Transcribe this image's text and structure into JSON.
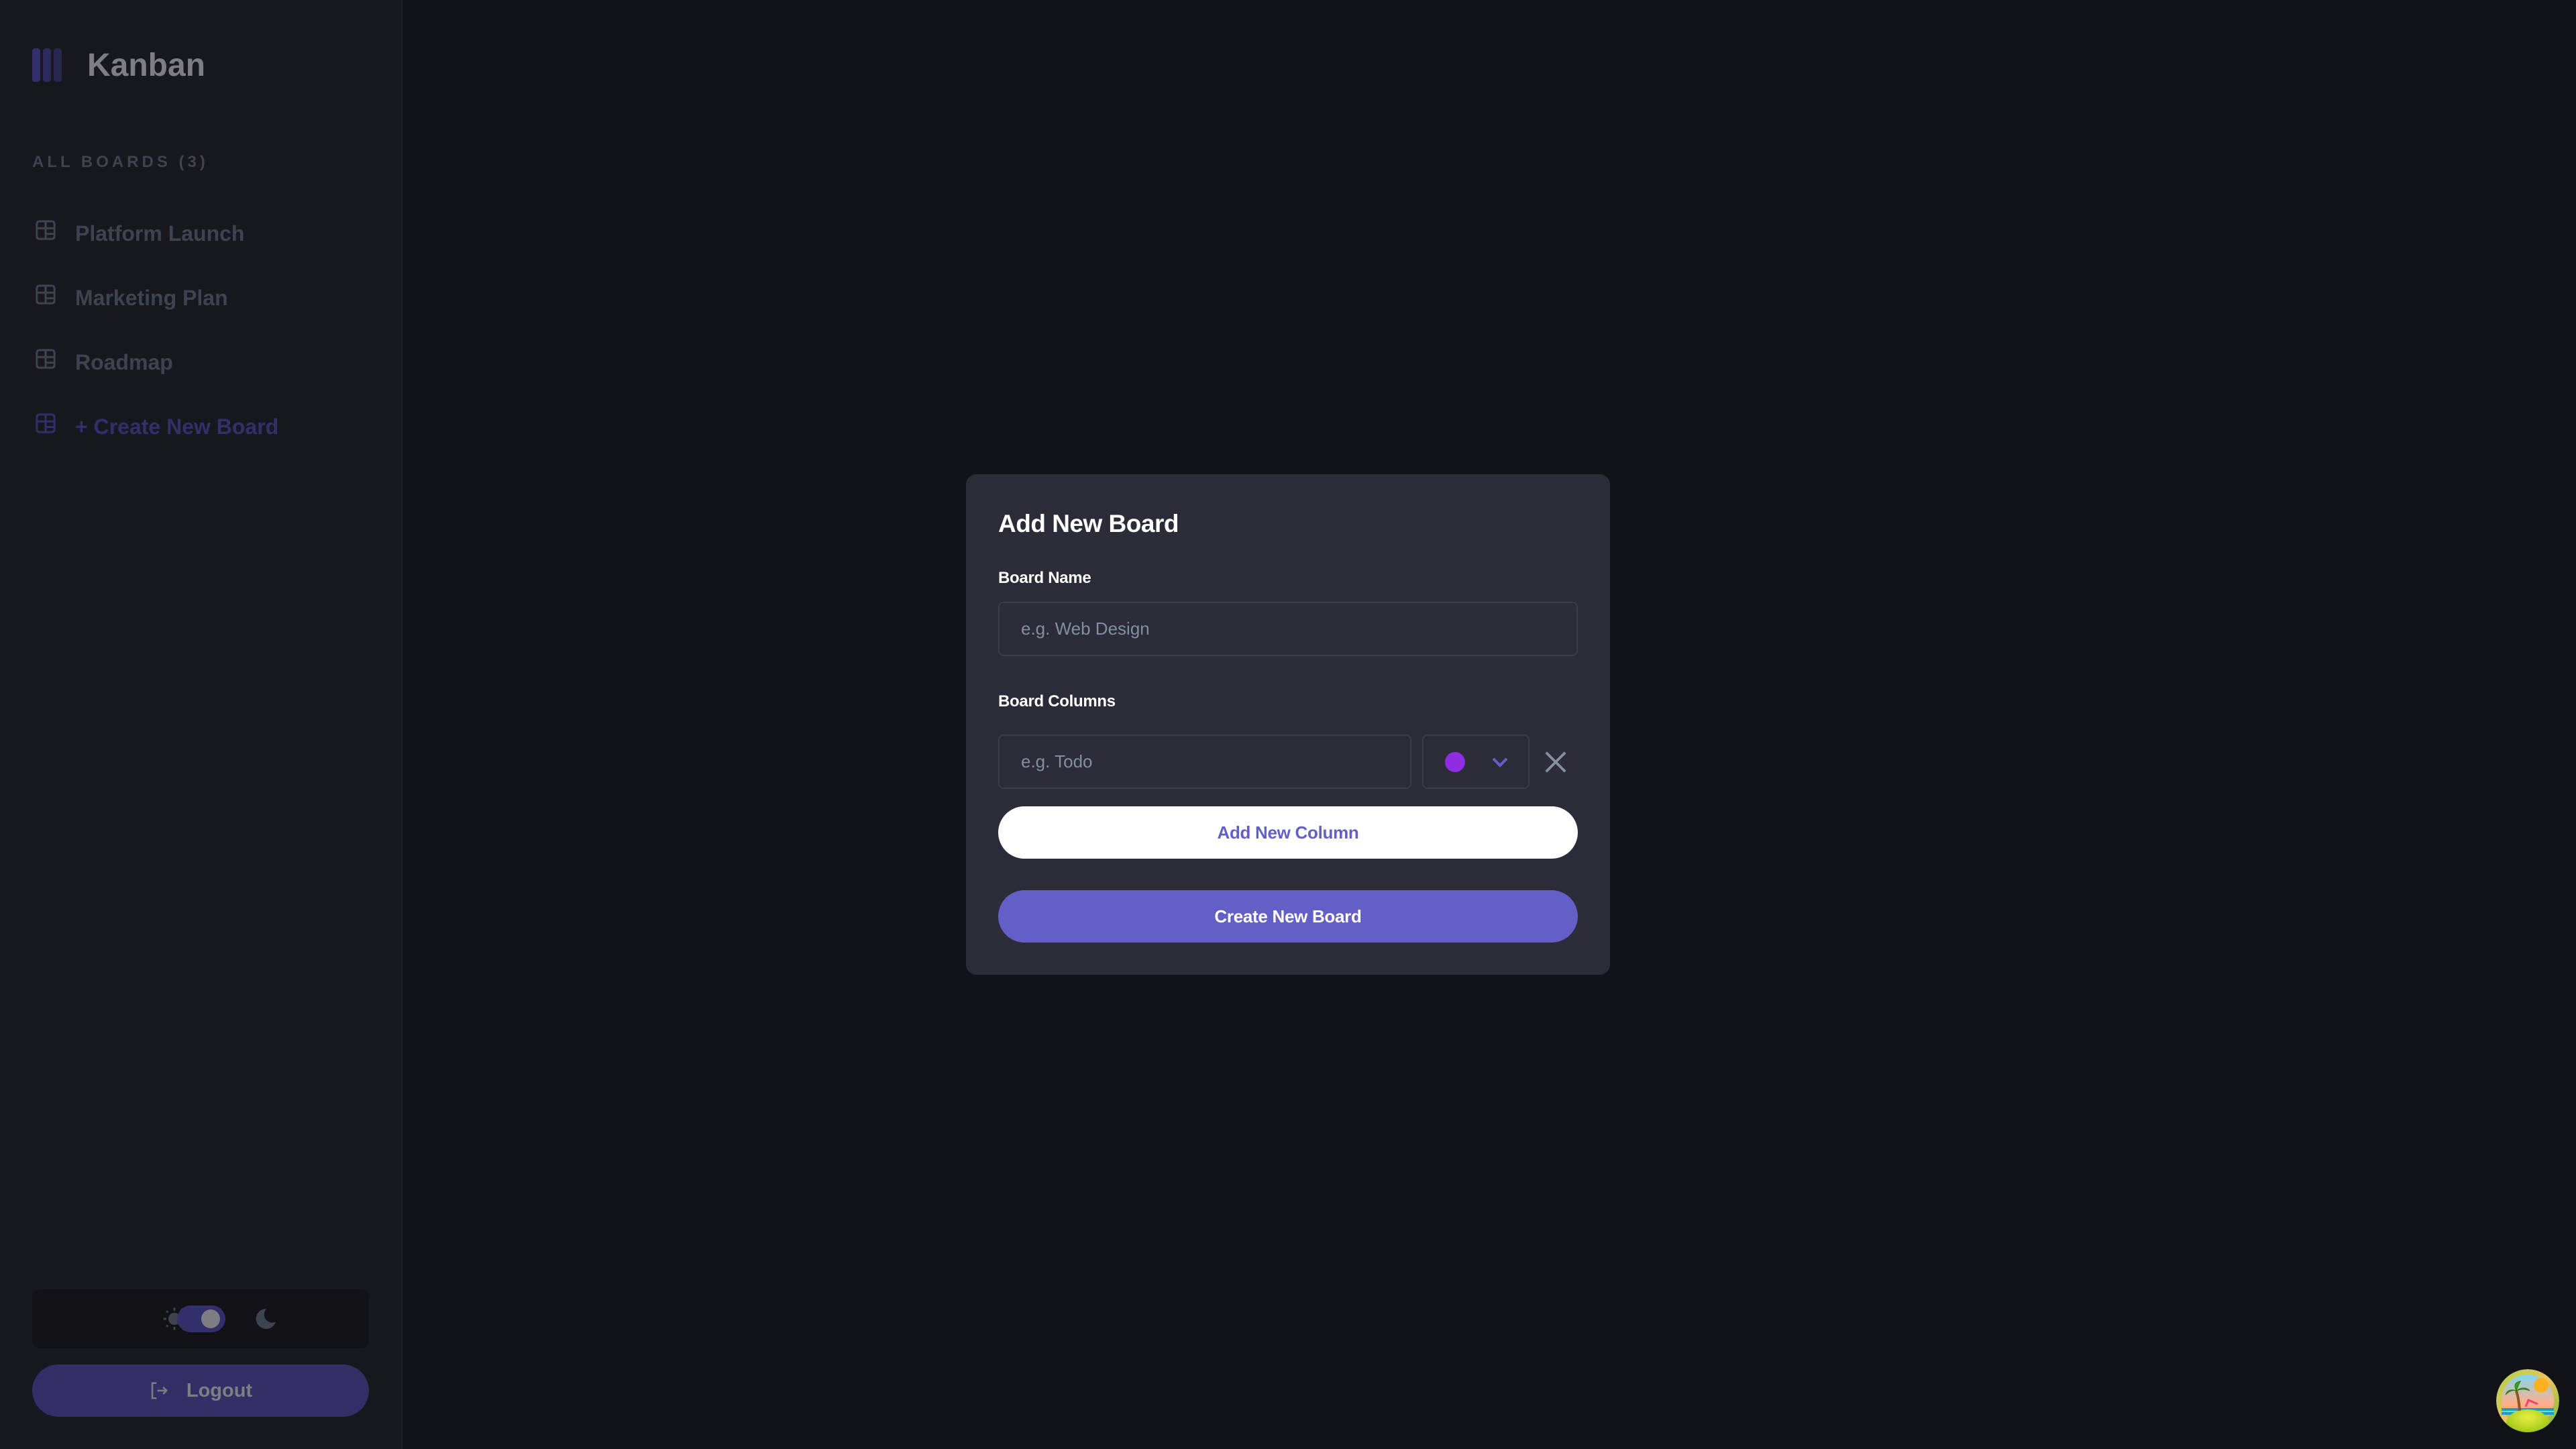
{
  "app": {
    "title": "Kanban"
  },
  "colors": {
    "accent": "#635fc7",
    "accent_dim": "#332f6a",
    "sidebar_bg": "#17181d",
    "main_bg": "#111118",
    "modal_bg": "#2b2c37",
    "muted_text": "#3e4350",
    "placeholder": "#828fa3",
    "column_color": "#8e2de2"
  },
  "sidebar": {
    "boards_label": "ALL BOARDS (3)",
    "boards": [
      {
        "label": "Platform Launch",
        "icon": "board-icon"
      },
      {
        "label": "Marketing Plan",
        "icon": "board-icon"
      },
      {
        "label": "Roadmap",
        "icon": "board-icon"
      }
    ],
    "create_label": "+ Create New Board",
    "theme": {
      "light_icon": "sun-icon",
      "dark_icon": "moon-icon",
      "mode": "dark"
    },
    "logout_label": "Logout",
    "logout_icon": "logout-icon"
  },
  "modal": {
    "title": "Add New Board",
    "board_name_label": "Board Name",
    "board_name_placeholder": "e.g. Web Design",
    "board_name_value": "",
    "columns_label": "Board Columns",
    "columns": [
      {
        "placeholder": "e.g. Todo",
        "value": "",
        "color": "#8e2de2"
      }
    ],
    "add_column_label": "Add New Column",
    "create_label": "Create New Board"
  },
  "avatar": {
    "icon": "tropical-island-avatar"
  }
}
